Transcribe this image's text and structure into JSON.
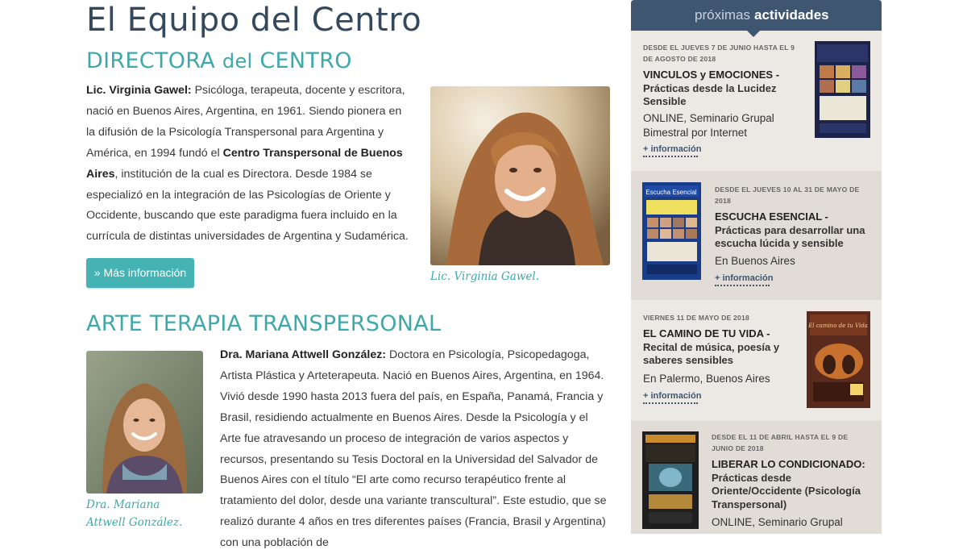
{
  "page": {
    "title": "El Equipo del Centro"
  },
  "directora": {
    "heading_main": "DIRECTORA",
    "heading_small": "del",
    "heading_end": "CENTRO",
    "name": "Lic. Virginia Gawel:",
    "text1": " Psicóloga, terapeuta, docente y escritora, nació en Buenos Aires, Argentina, en 1961. Siendo pionera en la difusión de la Psicología Transpersonal para Argentina y América, en 1994 fundó el ",
    "bold2": "Centro Transpersonal de Buenos Aires",
    "text2": ", institución de la cual es Directora. Desde 1984 se especializó en la integración de las Psicologías de Oriente y Occidente, buscando que este paradigma fuera incluido en la currícula de distintas universidades de Argentina y Sudamérica.",
    "button": "» Más información",
    "caption": "Lic. Virginia Gawel."
  },
  "arte": {
    "heading": "ARTE TERAPIA TRANSPERSONAL",
    "name": "Dra. Mariana Attwell González:",
    "text": " Doctora en Psicología, Psicopedagoga, Artista Plástica y Arteterapeuta. Nació en Buenos Aires, Argentina, en 1964. Vivió desde 1990 hasta 2013 fuera del país, en España, Panamá, Francia y Brasil, residiendo actualmente en Buenos Aires. Desde la Psicología y el Arte fue atravesando un proceso de integración de varios aspectos y recursos, presentando su Tesis Doctoral en la Universidad del Salvador de Buenos Aires con el título “El arte como recurso terapéutico frente al tratamiento del dolor, desde una variante transcultural”. Este estudio, que se realizó durante 4 años en tres diferentes países (Francia, Brasil y Argentina) con una población de",
    "caption": "Dra. Mariana Attwell González."
  },
  "sidebar": {
    "header_light": "próximas",
    "header_bold": "actividades",
    "more_label": "+ información",
    "events": [
      {
        "date": "DESDE EL JUEVES 7 DE JUNIO HASTA EL 9 DE AGOSTO DE 2018",
        "title": "VINCULOS y EMOCIONES -",
        "subtitle": "Prácticas desde la Lucidez Sensible",
        "desc": "ONLINE, Seminario Grupal Bimestral por Internet"
      },
      {
        "date": "DESDE EL JUEVES 10 AL 31 DE MAYO DE 2018",
        "title": "ESCUCHA ESENCIAL -",
        "subtitle": "Prácticas para desarrollar una escucha lúcida y sensible",
        "desc": "En Buenos Aires"
      },
      {
        "date": "VIERNES 11 DE MAYO DE 2018",
        "title": "EL CAMINO DE TU VIDA -",
        "subtitle": "Recital de música, poesía y saberes sensibles",
        "desc": "En Palermo, Buenos Aires"
      },
      {
        "date": "DESDE EL 11 DE ABRIL HASTA EL 9 DE JUNIO DE 2018",
        "title": "LIBERAR LO CONDICIONADO:",
        "subtitle": "Prácticas desde Oriente/Occidente (Psicología Transpersonal)",
        "desc": "ONLINE, Seminario Grupal"
      }
    ],
    "poster_texts": {
      "p2": "Escucha Esencial",
      "p3": "El camino de tu Vida"
    }
  },
  "colors": {
    "accent": "#45b3b3",
    "title": "#34495e",
    "sidebar_header": "#3f5670",
    "sidebar_bg": "#ece9e4"
  }
}
